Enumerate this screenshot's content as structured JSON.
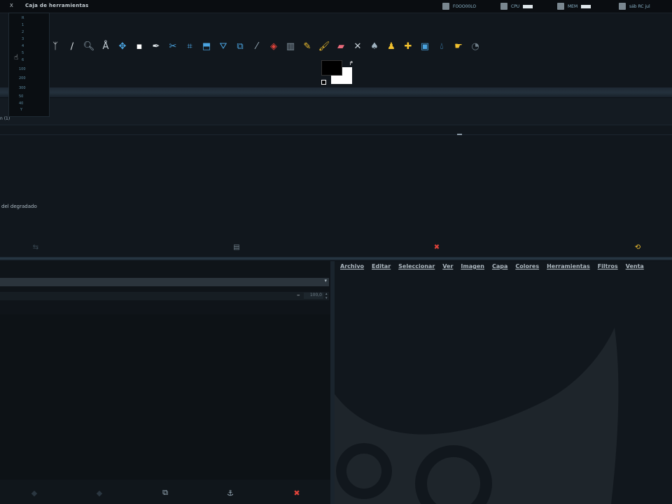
{
  "taskbar": {
    "window_title": "Caja de herramientas",
    "close_glyph": "X",
    "tray": [
      {
        "icon": "document-icon",
        "label": "FOOO00LO"
      },
      {
        "icon": "cpu-icon",
        "label": "CPU"
      },
      {
        "icon": "memory-icon",
        "label": "MEM"
      },
      {
        "icon": "clock-icon",
        "label": "sáb  RC  jul"
      }
    ]
  },
  "toolbox": {
    "tools": [
      "free-select-icon",
      "paths-icon",
      "zoom-icon",
      "measure-icon",
      "move-icon",
      "rect-icon",
      "color-picker-icon",
      "scissors-icon",
      "crop-icon",
      "rotate-icon",
      "perspective-icon",
      "flip-icon",
      "text-icon",
      "bucket-fill-icon",
      "blend-icon",
      "pencil-icon",
      "paintbrush-icon",
      "eraser-icon",
      "airbrush-icon",
      "ink-icon",
      "clone-icon",
      "heal-icon",
      "perspective-clone-icon",
      "blur-icon",
      "smudge-icon",
      "dodge-icon"
    ]
  },
  "dropdown": {
    "items": [
      "R",
      "1",
      "2",
      "3",
      "4",
      "5",
      "6",
      "100",
      "200",
      "300",
      "50",
      "40",
      "25",
      "10",
      "Y"
    ]
  },
  "options": {
    "panel_label": "n (1)",
    "gradient_label": "del degradado",
    "bottom_icons": [
      "save-preset-icon",
      "restore-preset-icon",
      "delete-preset-icon",
      "reset-icon"
    ]
  },
  "dock": {
    "opacity_value": "100,0",
    "buttons": [
      "new-layer-icon",
      "raise-layer-icon",
      "duplicate-layer-icon",
      "anchor-icon",
      "delete-layer-icon"
    ]
  },
  "image_window": {
    "menus": [
      "Archivo",
      "Editar",
      "Seleccionar",
      "Ver",
      "Imagen",
      "Capa",
      "Colores",
      "Herramientas",
      "Filtros",
      "Venta"
    ]
  },
  "colors": {
    "accent": "#4aa3df",
    "danger": "#e0433a",
    "warning": "#f2c12e",
    "background": "#0d1217"
  }
}
